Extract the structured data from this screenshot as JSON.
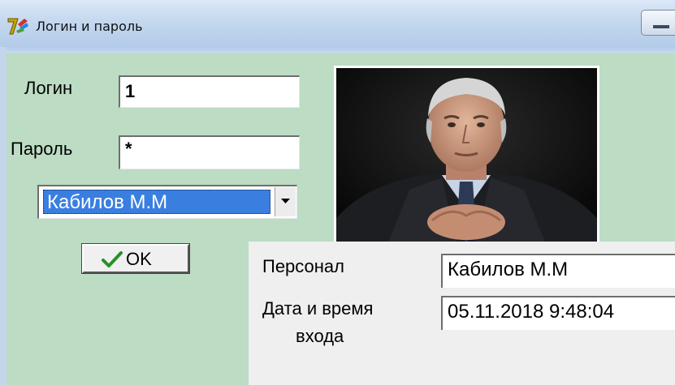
{
  "window": {
    "title": "Логин и пароль"
  },
  "form": {
    "login_label": "Логин",
    "login_value": "1",
    "password_label": "Пароль",
    "password_value": "*",
    "user_select_value": "Кабилов М.М",
    "ok_label": "OK"
  },
  "info": {
    "personnel_label": "Персонал",
    "personnel_value": "Кабилов М.М",
    "datetime_label_line1": "Дата и время",
    "datetime_label_line2": "входа",
    "datetime_value": "05.11.2018 9:48:04"
  },
  "icons": {
    "app": "delphi-app-icon",
    "combo": "chevron-down-icon",
    "ok": "check-icon",
    "minimize": "minimize-icon"
  },
  "colors": {
    "client_background": "#bcdcc4",
    "selection": "#3a7fe0",
    "check": "#2a8f2a"
  }
}
